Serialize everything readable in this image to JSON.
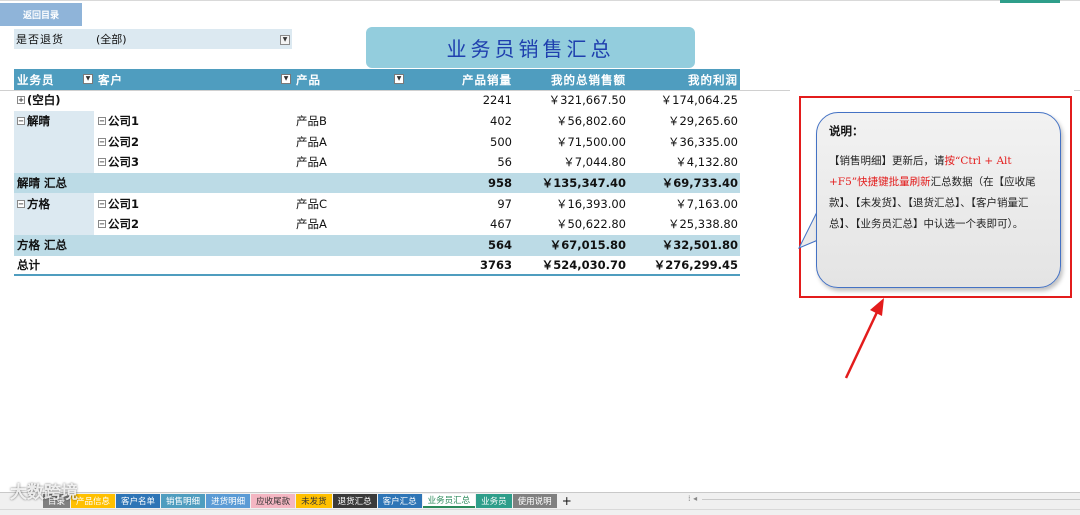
{
  "back_button": {
    "label": "返回目录"
  },
  "filter": {
    "label": "是否退货",
    "value": "(全部)",
    "arrow": "▼"
  },
  "report_title": "业务员销售汇总",
  "pivot": {
    "headers": {
      "salesperson": "业务员",
      "customer": "客户",
      "product": "产品",
      "qty": "产品销量",
      "total": "我的总销售额",
      "profit": "我的利润"
    },
    "rows": [
      {
        "salesperson": "(空白)",
        "customer": "",
        "product": "",
        "qty": "2241",
        "total": "￥321,667.50",
        "profit": "￥174,064.25"
      },
      {
        "salesperson": "解晴",
        "customer": "公司1",
        "product": "产品B",
        "qty": "402",
        "total": "￥56,802.60",
        "profit": "￥29,265.60"
      },
      {
        "salesperson": "",
        "customer": "公司2",
        "product": "产品A",
        "qty": "500",
        "total": "￥71,500.00",
        "profit": "￥36,335.00"
      },
      {
        "salesperson": "",
        "customer": "公司3",
        "product": "产品A",
        "qty": "56",
        "total": "￥7,044.80",
        "profit": "￥4,132.80"
      },
      {
        "label": "解晴 汇总",
        "qty": "958",
        "total": "￥135,347.40",
        "profit": "￥69,733.40"
      },
      {
        "salesperson": "方格",
        "customer": "公司1",
        "product": "产品C",
        "qty": "97",
        "total": "￥16,393.00",
        "profit": "￥7,163.00"
      },
      {
        "salesperson": "",
        "customer": "公司2",
        "product": "产品A",
        "qty": "467",
        "total": "￥50,622.80",
        "profit": "￥25,338.80"
      },
      {
        "label": "方格 汇总",
        "qty": "564",
        "total": "￥67,015.80",
        "profit": "￥32,501.80"
      },
      {
        "label": "总计",
        "qty": "3763",
        "total": "￥524,030.70",
        "profit": "￥276,299.45"
      }
    ]
  },
  "note": {
    "title": "说明：",
    "text_part1": "【销售明细】更新后，请",
    "text_red": "按“Ctrl + Alt +F5”快捷键批量刷新",
    "text_part2": "汇总数据（在【应收尾款】、【未发货】、【退货汇总】、【客户销量汇总】、【业务员汇总】中认选一个表即可）。"
  },
  "sheet_tabs": [
    {
      "label": "目录",
      "color": "#808080"
    },
    {
      "label": "产品信息",
      "color": "#ffc000"
    },
    {
      "label": "客户名单",
      "color": "#2e75b6"
    },
    {
      "label": "销售明细",
      "color": "#4f9dbf"
    },
    {
      "label": "进货明细",
      "color": "#5b9bd5"
    },
    {
      "label": "应收尾款",
      "color": "#f4b6c2"
    },
    {
      "label": "未发货",
      "color": "#ffc000"
    },
    {
      "label": "退货汇总",
      "color": "#3a3a3a"
    },
    {
      "label": "客户汇总",
      "color": "#2e75b6"
    },
    {
      "label": "业务员汇总",
      "color": "#ffffff",
      "active": true
    },
    {
      "label": "业务员",
      "color": "#2e9e8a"
    },
    {
      "label": "使用说明",
      "color": "#808080"
    }
  ],
  "add_tab": "+",
  "watermark": "大数跨境",
  "colors": {
    "header_blue": "#4f9dbf",
    "subtotal_blue": "#bcdbe6",
    "title_box": "#93cddd",
    "title_text": "#1f3fae",
    "note_red": "#e31c1c"
  }
}
